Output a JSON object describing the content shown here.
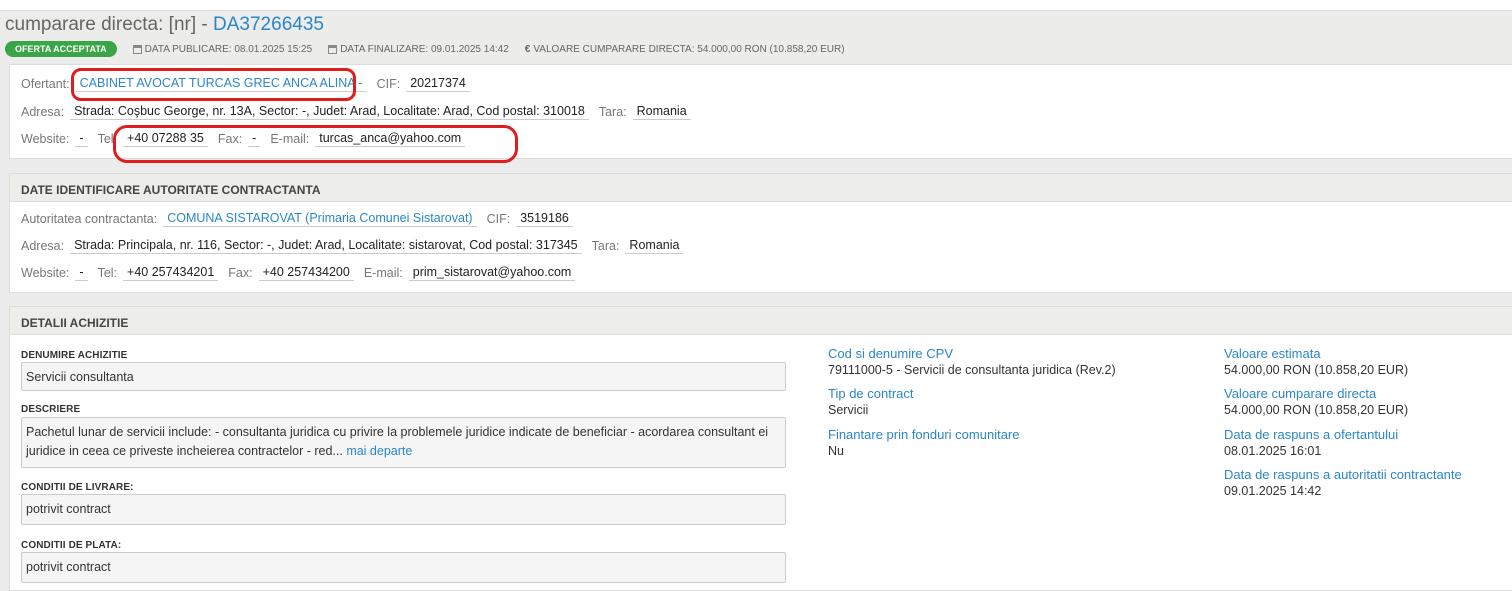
{
  "header": {
    "title_prefix": "cumparare directa: [nr] - ",
    "title_code": "DA37266435",
    "status": "OFERTA ACCEPTATA",
    "publish_date": "DATA PUBLICARE: 08.01.2025 15:25",
    "final_date": "DATA FINALIZARE: 09.01.2025 14:42",
    "value": "VALOARE CUMPARARE DIRECTA: 54.000,00  RON (10.858,20  EUR)"
  },
  "ofertant": {
    "name_label": "Ofertant:",
    "name": "CABINET AVOCAT TURCAS GREC ANCA ALINA -",
    "cif_label": "CIF:",
    "cif": "20217374",
    "address_label": "Adresa:",
    "address": "Strada: Coşbuc George, nr. 13A, Sector: -, Judet: Arad, Localitate: Arad, Cod postal: 310018",
    "country_label": "Tara:",
    "country": "Romania",
    "website_label": "Website:",
    "website": "-",
    "tel_label": "Tel:",
    "tel": "+40 07288  35",
    "fax_label": "Fax:",
    "fax": "-",
    "email_label": "E-mail:",
    "email": "turcas_anca@yahoo.com"
  },
  "authority": {
    "heading": "DATE IDENTIFICARE AUTORITATE CONTRACTANTA",
    "name_label": "Autoritatea contractanta:",
    "name": "COMUNA SISTAROVAT (Primaria Comunei Sistarovat)",
    "cif_label": "CIF:",
    "cif": "3519186",
    "address_label": "Adresa:",
    "address": "Strada: Principala, nr. 116, Sector: -, Judet: Arad, Localitate: sistarovat, Cod postal: 317345",
    "country_label": "Tara:",
    "country": "Romania",
    "website_label": "Website:",
    "website": "-",
    "tel_label": "Tel:",
    "tel": "+40 257434201",
    "fax_label": "Fax:",
    "fax": "+40 257434200",
    "email_label": "E-mail:",
    "email": "prim_sistarovat@yahoo.com"
  },
  "details": {
    "heading": "DETALII ACHIZITIE",
    "name_label": "DENUMIRE ACHIZITIE",
    "name": "Servicii consultanta",
    "description_label": "DESCRIERE",
    "description": "Pachetul lunar de servicii include: - consultanta juridica cu privire la problemele juridice indicate de beneficiar - acordarea consultant ei juridice in ceea ce priveste incheierea contractelor - red...",
    "more_link": "mai departe",
    "delivery_label": "CONDITII DE LIVRARE:",
    "delivery": "potrivit contract",
    "payment_label": "CONDITII DE PLATA:",
    "payment": "potrivit contract",
    "cpv_label": "Cod si denumire CPV",
    "cpv": "79111000-5 - Servicii de consultanta juridica (Rev.2)",
    "contract_type_label": "Tip de contract",
    "contract_type": "Servicii",
    "eu_funds_label": "Finantare prin fonduri comunitare",
    "eu_funds": "Nu",
    "estimated_label": "Valoare estimata",
    "estimated": "54.000,00  RON (10.858,20  EUR)",
    "direct_value_label": "Valoare cumparare directa",
    "direct_value": "54.000,00  RON (10.858,20  EUR)",
    "bidder_reply_label": "Data de raspuns a ofertantului",
    "bidder_reply": "08.01.2025 16:01",
    "authority_reply_label": "Data de raspuns a autoritatii contractante",
    "authority_reply": "09.01.2025 14:42"
  },
  "colors": {
    "accent": "#2a86c9",
    "status": "#3aa547",
    "annotation": "#e01d1d"
  }
}
